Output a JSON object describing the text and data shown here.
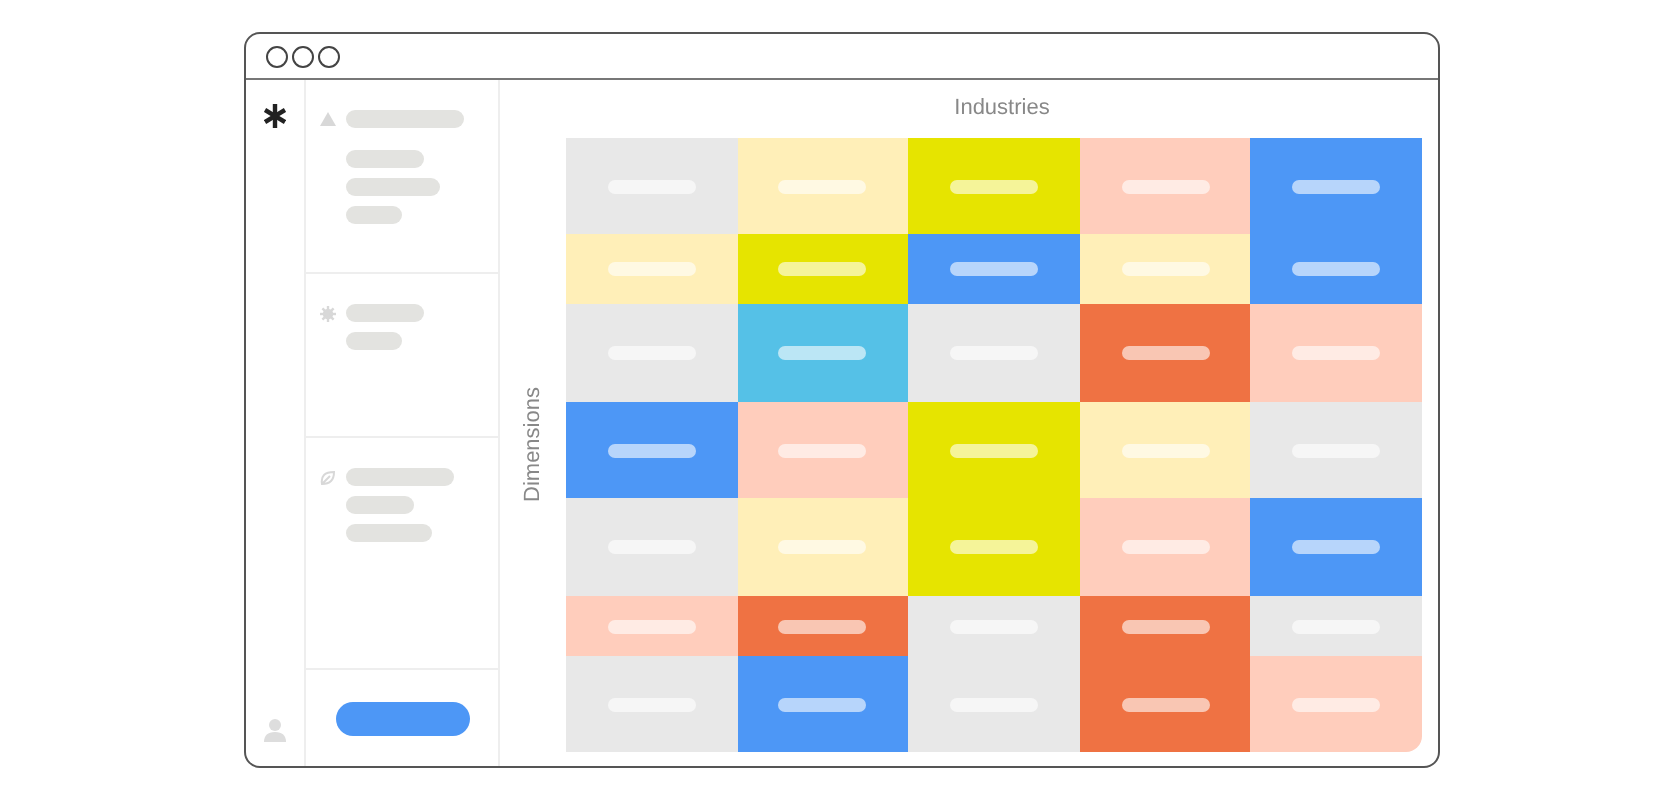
{
  "heatmap": {
    "column_axis": "Industries",
    "row_axis": "Dimensions",
    "rows": [
      [
        {
          "color": "#e8e8e8"
        },
        {
          "color": "#ffefb8"
        },
        {
          "color": "#e6e400"
        },
        {
          "color": "#ffcdbc"
        },
        {
          "color": "#4d97f6"
        }
      ],
      [
        {
          "color": "#ffefb8"
        },
        {
          "color": "#e6e400"
        },
        {
          "color": "#4d97f6"
        },
        {
          "color": "#ffefb8"
        },
        {
          "color": "#4d97f6"
        }
      ],
      [
        {
          "color": "#e8e8e8"
        },
        {
          "color": "#55c1e7"
        },
        {
          "color": "#e8e8e8"
        },
        {
          "color": "#ef7243"
        },
        {
          "color": "#ffcdbc"
        }
      ],
      [
        {
          "color": "#4d97f6"
        },
        {
          "color": "#ffcdbc"
        },
        {
          "color": "#e6e400"
        },
        {
          "color": "#ffefb8"
        },
        {
          "color": "#e8e8e8"
        }
      ],
      [
        {
          "color": "#e8e8e8"
        },
        {
          "color": "#ffefb8"
        },
        {
          "color": "#e6e400"
        },
        {
          "color": "#ffcdbc"
        },
        {
          "color": "#4d97f6"
        }
      ],
      [
        {
          "color": "#ffcdbc"
        },
        {
          "color": "#ef7243"
        },
        {
          "color": "#e8e8e8"
        },
        {
          "color": "#ef7243"
        },
        {
          "color": "#e8e8e8"
        }
      ],
      [
        {
          "color": "#e8e8e8"
        },
        {
          "color": "#4d97f6"
        },
        {
          "color": "#e8e8e8"
        },
        {
          "color": "#ef7243"
        },
        {
          "color": "#ffcdbc"
        }
      ]
    ]
  }
}
